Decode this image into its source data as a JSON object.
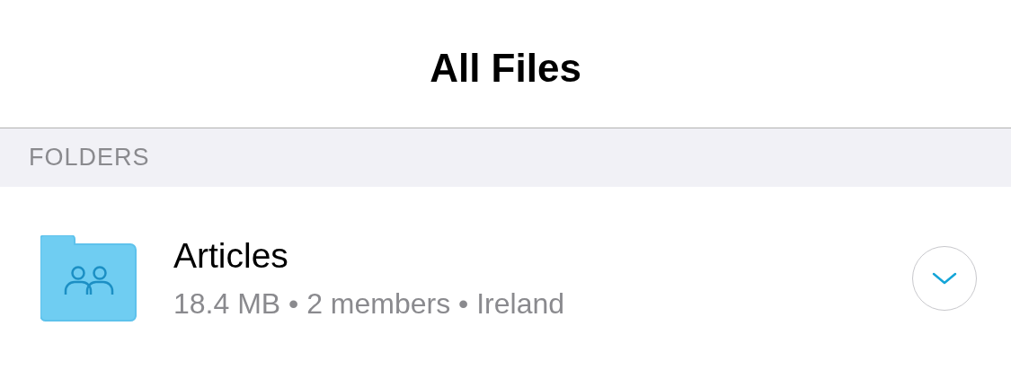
{
  "title": "All Files",
  "section": {
    "label": "FOLDERS"
  },
  "folders": [
    {
      "name": "Articles",
      "details": "18.4 MB • 2 members • Ireland",
      "shared": true,
      "expanded": false
    }
  ]
}
